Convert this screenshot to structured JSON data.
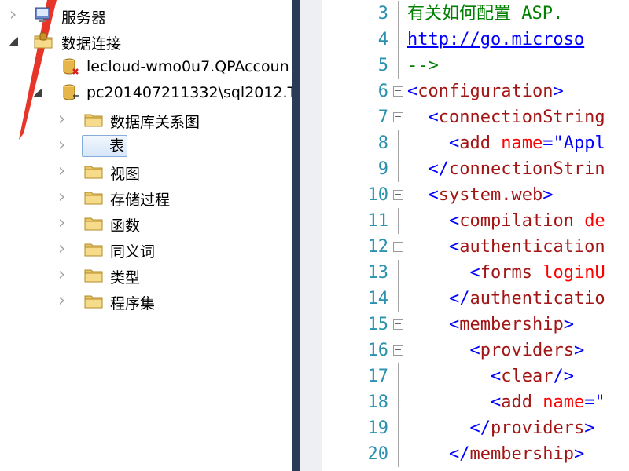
{
  "tree": {
    "items": [
      {
        "label": "服务器",
        "expander": "collapsed",
        "icon": "server-icon"
      },
      {
        "label": "数据连接",
        "expander": "expanded",
        "icon": "folder-db-icon"
      },
      {
        "label": "lecloud-wmo0u7.QPAccoun",
        "expander": "none",
        "icon": "database-error-icon"
      },
      {
        "label": "pc201407211332\\sql2012.T",
        "expander": "expanded",
        "icon": "database-connected-icon"
      },
      {
        "label": "数据库关系图",
        "expander": "collapsed",
        "icon": "folder-icon"
      },
      {
        "label": "表",
        "expander": "collapsed",
        "icon": "folder-icon",
        "selected": true
      },
      {
        "label": "视图",
        "expander": "collapsed",
        "icon": "folder-icon"
      },
      {
        "label": "存储过程",
        "expander": "collapsed",
        "icon": "folder-icon"
      },
      {
        "label": "函数",
        "expander": "collapsed",
        "icon": "folder-icon"
      },
      {
        "label": "同义词",
        "expander": "collapsed",
        "icon": "folder-icon"
      },
      {
        "label": "类型",
        "expander": "collapsed",
        "icon": "folder-icon"
      },
      {
        "label": "程序集",
        "expander": "collapsed",
        "icon": "folder-icon"
      }
    ]
  },
  "editor": {
    "lines": [
      {
        "n": "3",
        "fold": "",
        "tokens": [
          [
            "c-comment",
            "有关如何配置 ASP."
          ]
        ]
      },
      {
        "n": "4",
        "fold": "",
        "tokens": [
          [
            "c-link",
            "http://go.microso"
          ]
        ]
      },
      {
        "n": "5",
        "fold": "",
        "tokens": [
          [
            "c-comment",
            "-->"
          ]
        ]
      },
      {
        "n": "6",
        "fold": "−",
        "tokens": [
          [
            "c-delim",
            "<"
          ],
          [
            "c-tag",
            "configuration"
          ],
          [
            "c-delim",
            ">"
          ]
        ]
      },
      {
        "n": "7",
        "fold": "−",
        "tokens": [
          [
            "",
            "  "
          ],
          [
            "c-delim",
            "<"
          ],
          [
            "c-tag",
            "connectionString"
          ]
        ]
      },
      {
        "n": "8",
        "fold": "",
        "tokens": [
          [
            "",
            "    "
          ],
          [
            "c-delim",
            "<"
          ],
          [
            "c-tag",
            "add "
          ],
          [
            "c-attr",
            "name"
          ],
          [
            "c-delim",
            "=\""
          ],
          [
            "c-val",
            "Appl"
          ]
        ]
      },
      {
        "n": "9",
        "fold": "",
        "tokens": [
          [
            "",
            "  "
          ],
          [
            "c-delim",
            "</"
          ],
          [
            "c-tag",
            "connectionStrin"
          ]
        ]
      },
      {
        "n": "10",
        "fold": "−",
        "tokens": [
          [
            "",
            "  "
          ],
          [
            "c-delim",
            "<"
          ],
          [
            "c-tag",
            "system.web"
          ],
          [
            "c-delim",
            ">"
          ]
        ]
      },
      {
        "n": "11",
        "fold": "",
        "tokens": [
          [
            "",
            "    "
          ],
          [
            "c-delim",
            "<"
          ],
          [
            "c-tag",
            "compilation "
          ],
          [
            "c-attr",
            "de"
          ]
        ]
      },
      {
        "n": "12",
        "fold": "−",
        "tokens": [
          [
            "",
            "    "
          ],
          [
            "c-delim",
            "<"
          ],
          [
            "c-tag",
            "authentication"
          ]
        ]
      },
      {
        "n": "13",
        "fold": "",
        "tokens": [
          [
            "",
            "      "
          ],
          [
            "c-delim",
            "<"
          ],
          [
            "c-tag",
            "forms "
          ],
          [
            "c-attr",
            "loginU"
          ]
        ]
      },
      {
        "n": "14",
        "fold": "",
        "tokens": [
          [
            "",
            "    "
          ],
          [
            "c-delim",
            "</"
          ],
          [
            "c-tag",
            "authenticatio"
          ]
        ]
      },
      {
        "n": "15",
        "fold": "−",
        "tokens": [
          [
            "",
            "    "
          ],
          [
            "c-delim",
            "<"
          ],
          [
            "c-tag",
            "membership"
          ],
          [
            "c-delim",
            ">"
          ]
        ]
      },
      {
        "n": "16",
        "fold": "−",
        "tokens": [
          [
            "",
            "      "
          ],
          [
            "c-delim",
            "<"
          ],
          [
            "c-tag",
            "providers"
          ],
          [
            "c-delim",
            ">"
          ]
        ]
      },
      {
        "n": "17",
        "fold": "",
        "tokens": [
          [
            "",
            "        "
          ],
          [
            "c-delim",
            "<"
          ],
          [
            "c-tag",
            "clear"
          ],
          [
            "c-delim",
            "/>"
          ]
        ]
      },
      {
        "n": "18",
        "fold": "",
        "tokens": [
          [
            "",
            "        "
          ],
          [
            "c-delim",
            "<"
          ],
          [
            "c-tag",
            "add "
          ],
          [
            "c-attr",
            "name"
          ],
          [
            "c-delim",
            "=\""
          ]
        ]
      },
      {
        "n": "19",
        "fold": "",
        "tokens": [
          [
            "",
            "      "
          ],
          [
            "c-delim",
            "</"
          ],
          [
            "c-tag",
            "providers"
          ],
          [
            "c-delim",
            ">"
          ]
        ]
      },
      {
        "n": "20",
        "fold": "",
        "tokens": [
          [
            "",
            "    "
          ],
          [
            "c-delim",
            "</"
          ],
          [
            "c-tag",
            "membership"
          ],
          [
            "c-delim",
            ">"
          ]
        ]
      }
    ]
  },
  "colors": {
    "splitter": "#2b3a55",
    "line_number": "#2b91af",
    "comment": "#008000",
    "tag": "#a31515",
    "attribute": "#ff0000",
    "delimiter": "#0000ff",
    "annotation_arrow": "#e8352a"
  }
}
